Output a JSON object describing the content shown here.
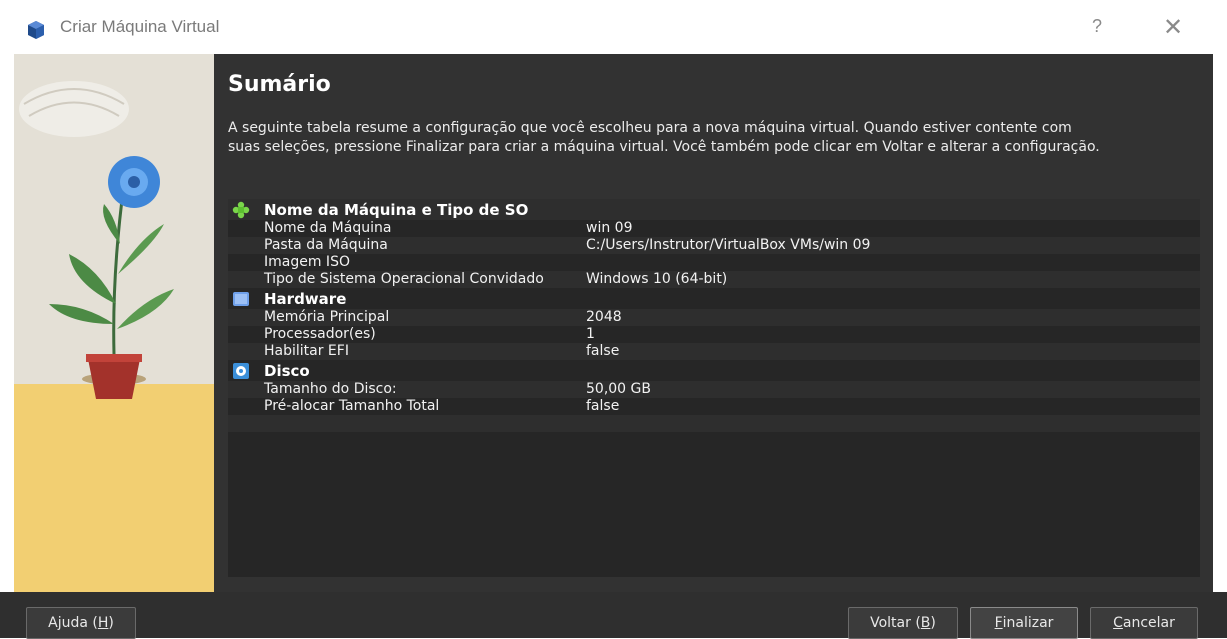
{
  "window": {
    "title": "Criar Máquina Virtual",
    "help_label": "?",
    "close_label": "✕",
    "app_icon": "virtualbox-icon"
  },
  "summary": {
    "heading": "Sumário",
    "description": "A seguinte tabela resume a configuração que você escolheu para a nova máquina virtual. Quando estiver contente com suas seleções, pressione Finalizar para criar a máquina virtual. Você também pode clicar em Voltar e alterar a configuração."
  },
  "sections": [
    {
      "title": "Nome da Máquina e Tipo de SO",
      "icon": "puzzle-icon",
      "rows": [
        {
          "key": "Nome da Máquina",
          "value": "win 09"
        },
        {
          "key": "Pasta da Máquina",
          "value": "C:/Users/Instrutor/VirtualBox VMs/win 09"
        },
        {
          "key": "Imagem ISO",
          "value": ""
        },
        {
          "key": "Tipo de Sistema Operacional Convidado",
          "value": "Windows 10 (64-bit)"
        }
      ]
    },
    {
      "title": "Hardware",
      "icon": "chip-icon",
      "rows": [
        {
          "key": "Memória Principal",
          "value": "2048"
        },
        {
          "key": "Processador(es)",
          "value": "1"
        },
        {
          "key": "Habilitar EFI",
          "value": "false"
        }
      ]
    },
    {
      "title": "Disco",
      "icon": "disk-icon",
      "rows": [
        {
          "key": "Tamanho do Disco:",
          "value": "50,00 GB"
        },
        {
          "key": "Pré-alocar Tamanho Total",
          "value": "false"
        }
      ]
    }
  ],
  "buttons": {
    "help": {
      "label": "Ajuda (",
      "mnemonic": "H",
      "suffix": ")"
    },
    "back": {
      "label": "Voltar (",
      "mnemonic": "B",
      "suffix": ")"
    },
    "finish": {
      "label": "",
      "mnemonic": "F",
      "suffix": "inalizar"
    },
    "cancel": {
      "label": "",
      "mnemonic": "C",
      "suffix": "ancelar"
    }
  }
}
